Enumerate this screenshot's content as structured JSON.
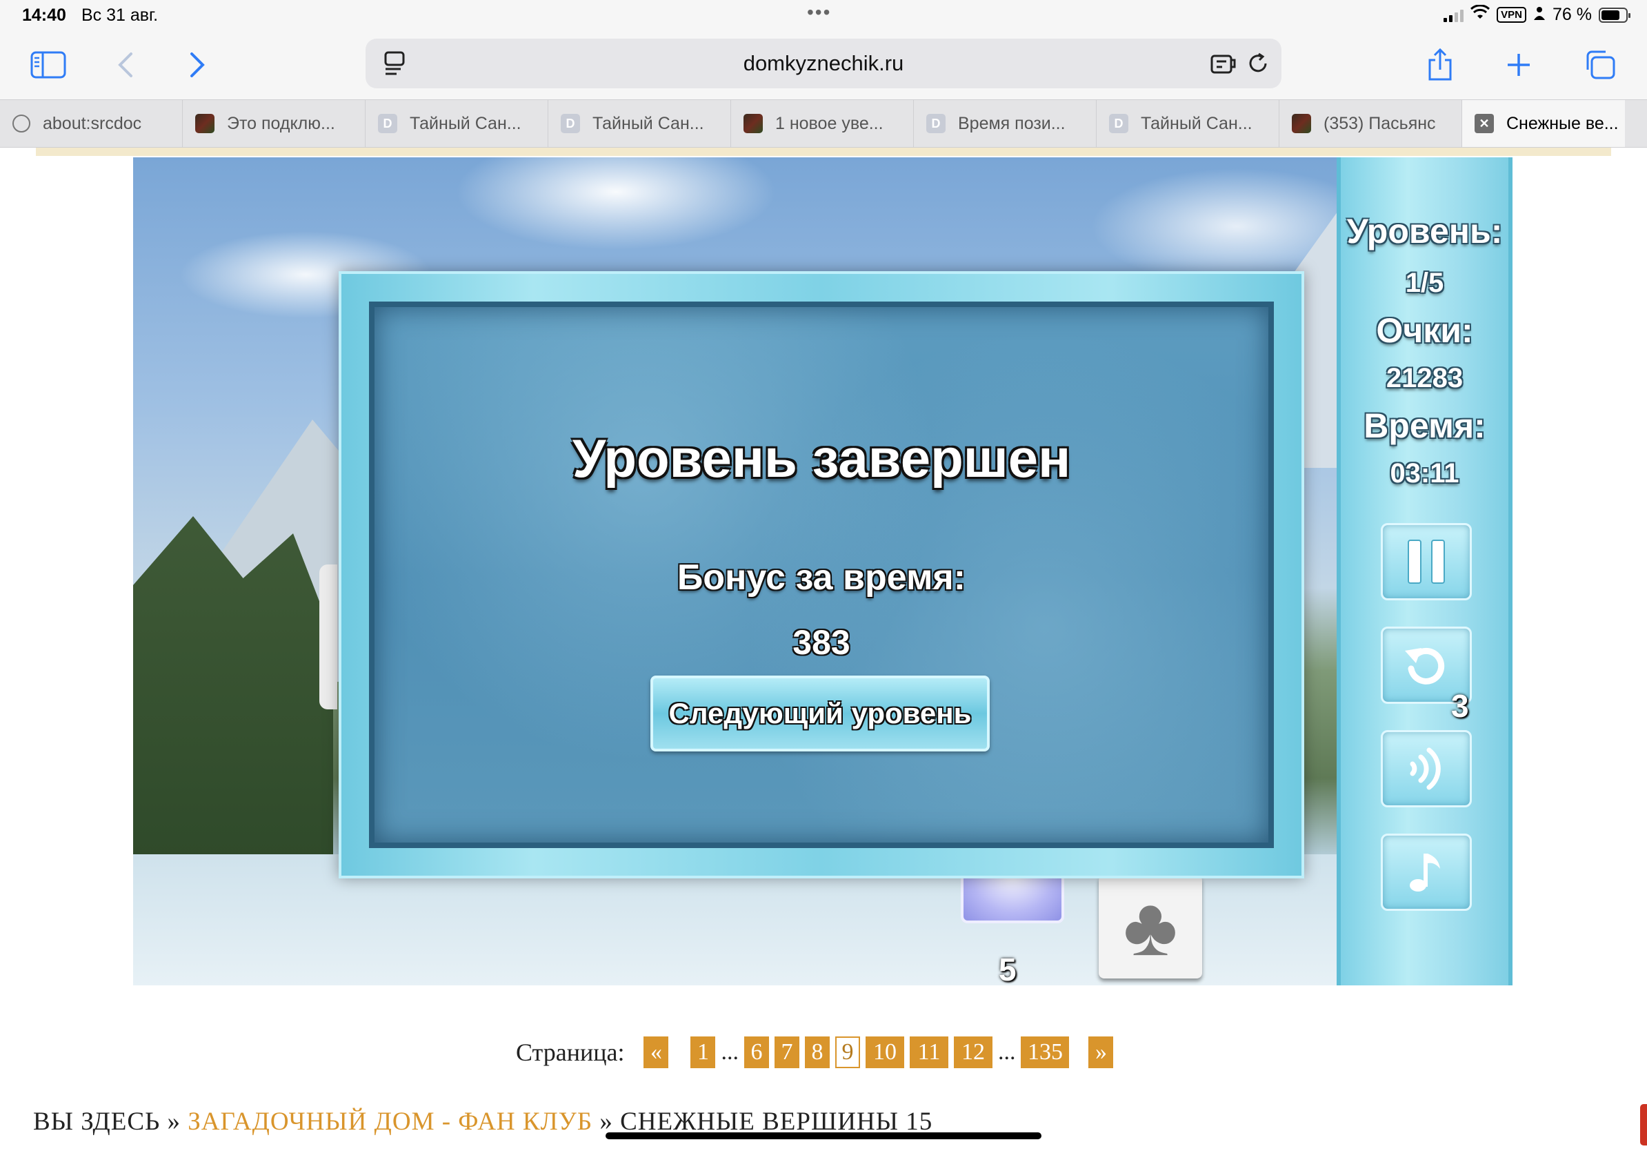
{
  "status_bar": {
    "time": "14:40",
    "date": "Вс 31 авг.",
    "dots": "•••",
    "vpn": "VPN",
    "battery_text": "76 %",
    "battery_level": 0.76
  },
  "toolbar": {
    "url": "domkyznechik.ru"
  },
  "tabs": [
    {
      "title": "about:srcdoc",
      "favicon": "globe-icon"
    },
    {
      "title": "Это подклю...",
      "favicon": "site-dark"
    },
    {
      "title": "Тайный Сан...",
      "favicon": "D"
    },
    {
      "title": "Тайный Сан...",
      "favicon": "D"
    },
    {
      "title": "1 новое уве...",
      "favicon": "site-dark"
    },
    {
      "title": "Время пози...",
      "favicon": "D"
    },
    {
      "title": "Тайный Сан...",
      "favicon": "D"
    },
    {
      "title": "(353) Пасьянс",
      "favicon": "site-dark"
    },
    {
      "title": "Снежные ве...",
      "favicon": "close-icon",
      "active": true
    }
  ],
  "game": {
    "side_panel": {
      "level_label": "Уровень:",
      "level_value": "1/5",
      "score_label": "Очки:",
      "score_value": "21283",
      "time_label": "Время:",
      "time_value": "03:11",
      "undo_count": "3"
    },
    "board": {
      "stock_count": "5"
    },
    "dialog": {
      "title": "Уровень завершен",
      "bonus_label": "Бонус за время:",
      "bonus_value": "383",
      "next_button": "Следующий уровень"
    }
  },
  "pagination": {
    "label": "Страница:",
    "prev": "«",
    "first": "1",
    "ellipsis": "...",
    "pages": [
      "6",
      "7",
      "8",
      "9",
      "10",
      "11",
      "12"
    ],
    "current": "9",
    "last": "135",
    "next": "»"
  },
  "breadcrumb": {
    "prefix": "ВЫ ЗДЕСЬ »",
    "link": "ЗАГАДОЧНЫЙ ДОМ - ФАН КЛУБ",
    "separator": "»",
    "current": "СНЕЖНЫЕ ВЕРШИНЫ 15"
  },
  "colors": {
    "accent": "#2f7cf6",
    "pager": "#d9952c",
    "dialog_frame": "#7fd2e6",
    "dialog_inner": "#4f8fb5"
  }
}
